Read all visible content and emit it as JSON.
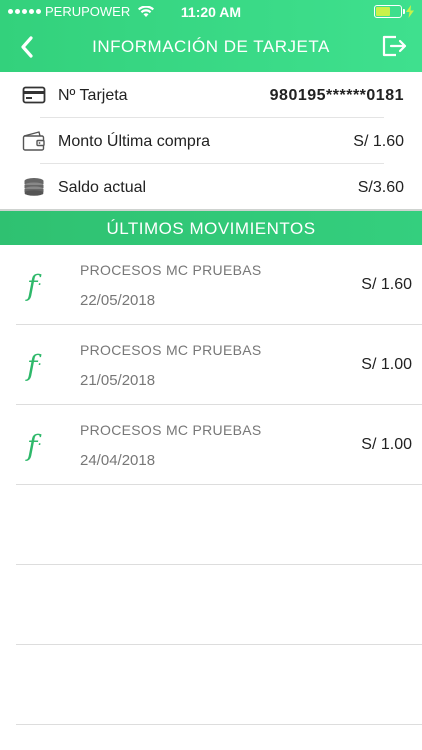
{
  "status_bar": {
    "carrier": "PERUPOWER",
    "time": "11:20 AM"
  },
  "header": {
    "title": "INFORMACIÓN DE TARJETA",
    "back_icon": "chevron-left-icon",
    "logout_icon": "logout-icon"
  },
  "card_info": {
    "number_label": "Nº Tarjeta",
    "number_value": "980195******0181",
    "last_purchase_label": "Monto Última compra",
    "last_purchase_value": "S/ 1.60",
    "balance_label": "Saldo actual",
    "balance_value": "S/3.60"
  },
  "movements_title": "ÚLTIMOS MOVIMIENTOS",
  "movements": [
    {
      "merchant": "PROCESOS MC PRUEBAS",
      "date": "22/05/2018",
      "amount": "S/ 1.60"
    },
    {
      "merchant": "PROCESOS MC PRUEBAS",
      "date": "21/05/2018",
      "amount": "S/ 1.00"
    },
    {
      "merchant": "PROCESOS MC PRUEBAS",
      "date": "24/04/2018",
      "amount": "S/ 1.00"
    }
  ],
  "movement_logo_glyph": "f",
  "colors": {
    "primary_green": "#33d17c",
    "logo_green": "#2eb86a"
  }
}
